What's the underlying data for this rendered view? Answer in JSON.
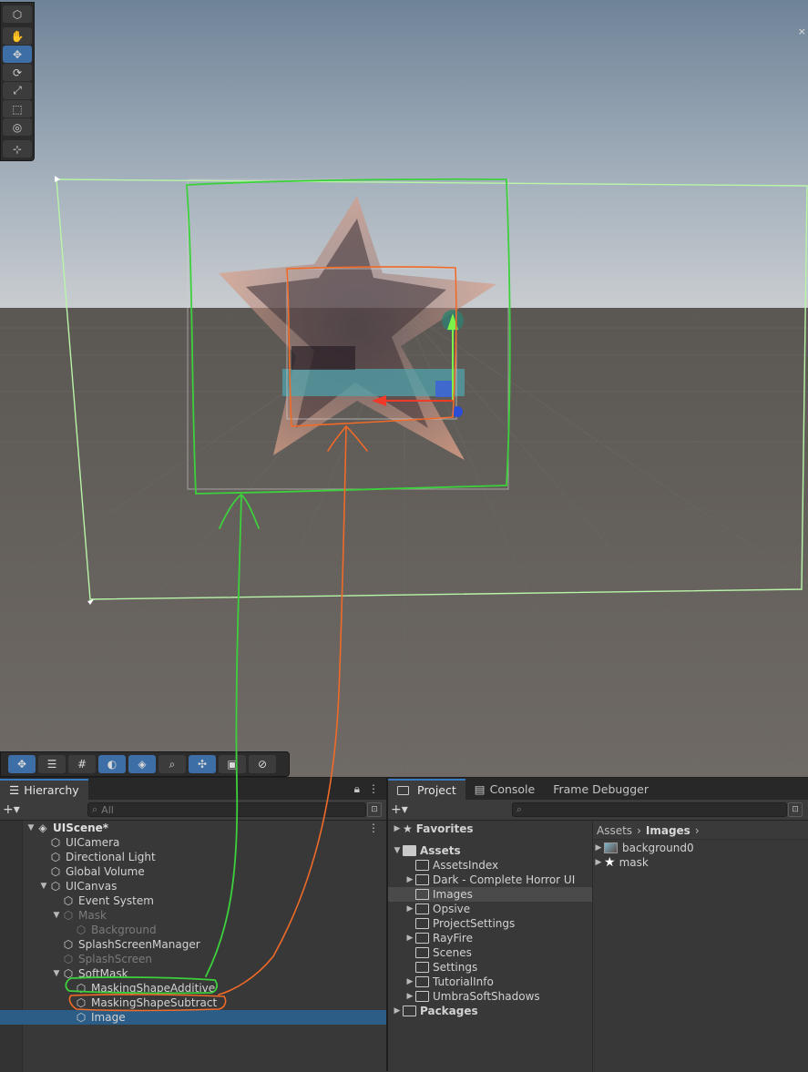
{
  "colors": {
    "accent": "#3a79bb",
    "selection": "#2c5d87",
    "annot_green": "#3cd13c",
    "annot_orange": "#f06a28"
  },
  "scene": {
    "tools": [
      {
        "icon": "cube-icon",
        "glyph": "⬡"
      },
      {
        "icon": "hand-icon",
        "glyph": "✋"
      },
      {
        "icon": "move-icon",
        "glyph": "✥"
      },
      {
        "icon": "rotate-icon",
        "glyph": "⟳"
      },
      {
        "icon": "scale-icon",
        "glyph": "⤢"
      },
      {
        "icon": "rect-icon",
        "glyph": "⬚"
      },
      {
        "icon": "transform-icon",
        "glyph": "◎"
      },
      {
        "icon": "custom-tool-icon",
        "glyph": "⊹"
      }
    ],
    "overlay_tools": [
      {
        "icon": "move-icon",
        "glyph": "✥"
      },
      {
        "icon": "sliders-icon",
        "glyph": "☰"
      },
      {
        "icon": "grid-icon",
        "glyph": "#"
      },
      {
        "icon": "shading-icon",
        "glyph": "◐"
      },
      {
        "icon": "layers-icon",
        "glyph": "◈"
      },
      {
        "icon": "search-icon",
        "glyph": "⌕"
      },
      {
        "icon": "pivot-icon",
        "glyph": "✣"
      },
      {
        "icon": "camera-icon",
        "glyph": "▣"
      },
      {
        "icon": "compass-icon",
        "glyph": "⊘"
      }
    ],
    "close_glyph": "×"
  },
  "hierarchy": {
    "tab_label": "Hierarchy",
    "search_placeholder": "All",
    "rows": [
      {
        "label": "UIScene*",
        "depth": 0,
        "arrow": "▼",
        "bold": true,
        "menu": "⋮"
      },
      {
        "label": "UICamera",
        "depth": 1,
        "arrow": ""
      },
      {
        "label": "Directional Light",
        "depth": 1,
        "arrow": ""
      },
      {
        "label": "Global Volume",
        "depth": 1,
        "arrow": ""
      },
      {
        "label": "UICanvas",
        "depth": 1,
        "arrow": "▼"
      },
      {
        "label": "Event System",
        "depth": 2,
        "arrow": ""
      },
      {
        "label": "Mask",
        "depth": 2,
        "arrow": "▼",
        "dim": true
      },
      {
        "label": "Background",
        "depth": 3,
        "arrow": "",
        "dim": true
      },
      {
        "label": "SplashScreenManager",
        "depth": 2,
        "arrow": ""
      },
      {
        "label": "SplashScreen",
        "depth": 2,
        "arrow": "",
        "dim": true
      },
      {
        "label": "SoftMask",
        "depth": 2,
        "arrow": "▼"
      },
      {
        "label": "MaskingShapeAdditive",
        "depth": 3,
        "arrow": ""
      },
      {
        "label": "MaskingShapeSubtract",
        "depth": 3,
        "arrow": ""
      },
      {
        "label": "Image",
        "depth": 3,
        "arrow": "",
        "selected": true
      }
    ]
  },
  "project": {
    "tabs": [
      {
        "label": "Project",
        "icon": "folder-icon",
        "active": true
      },
      {
        "label": "Console",
        "icon": "console-icon",
        "active": false
      },
      {
        "label": "Frame Debugger",
        "icon": "",
        "active": false
      }
    ],
    "breadcrumb": [
      "Assets",
      "Images"
    ],
    "tree": [
      {
        "label": "Favorites",
        "depth": 0,
        "arrow": "▶",
        "bold": true,
        "icon": "star"
      },
      {
        "label": "",
        "depth": 0,
        "spacer": true
      },
      {
        "label": "Assets",
        "depth": 0,
        "arrow": "▼",
        "bold": true,
        "icon": "folder-open"
      },
      {
        "label": "AssetsIndex",
        "depth": 1,
        "arrow": "",
        "icon": "folder"
      },
      {
        "label": "Dark - Complete Horror UI",
        "depth": 1,
        "arrow": "▶",
        "icon": "folder"
      },
      {
        "label": "Images",
        "depth": 1,
        "arrow": "",
        "icon": "folder",
        "selected": true
      },
      {
        "label": "Opsive",
        "depth": 1,
        "arrow": "▶",
        "icon": "folder"
      },
      {
        "label": "ProjectSettings",
        "depth": 1,
        "arrow": "",
        "icon": "folder"
      },
      {
        "label": "RayFire",
        "depth": 1,
        "arrow": "▶",
        "icon": "folder"
      },
      {
        "label": "Scenes",
        "depth": 1,
        "arrow": "",
        "icon": "folder"
      },
      {
        "label": "Settings",
        "depth": 1,
        "arrow": "",
        "icon": "folder"
      },
      {
        "label": "TutorialInfo",
        "depth": 1,
        "arrow": "▶",
        "icon": "folder"
      },
      {
        "label": "UmbraSoftShadows",
        "depth": 1,
        "arrow": "▶",
        "icon": "folder"
      },
      {
        "label": "Packages",
        "depth": 0,
        "arrow": "▶",
        "bold": true,
        "icon": "folder"
      }
    ],
    "files": [
      {
        "label": "background0",
        "icon": "image-icon"
      },
      {
        "label": "mask",
        "icon": "star-icon"
      }
    ]
  }
}
